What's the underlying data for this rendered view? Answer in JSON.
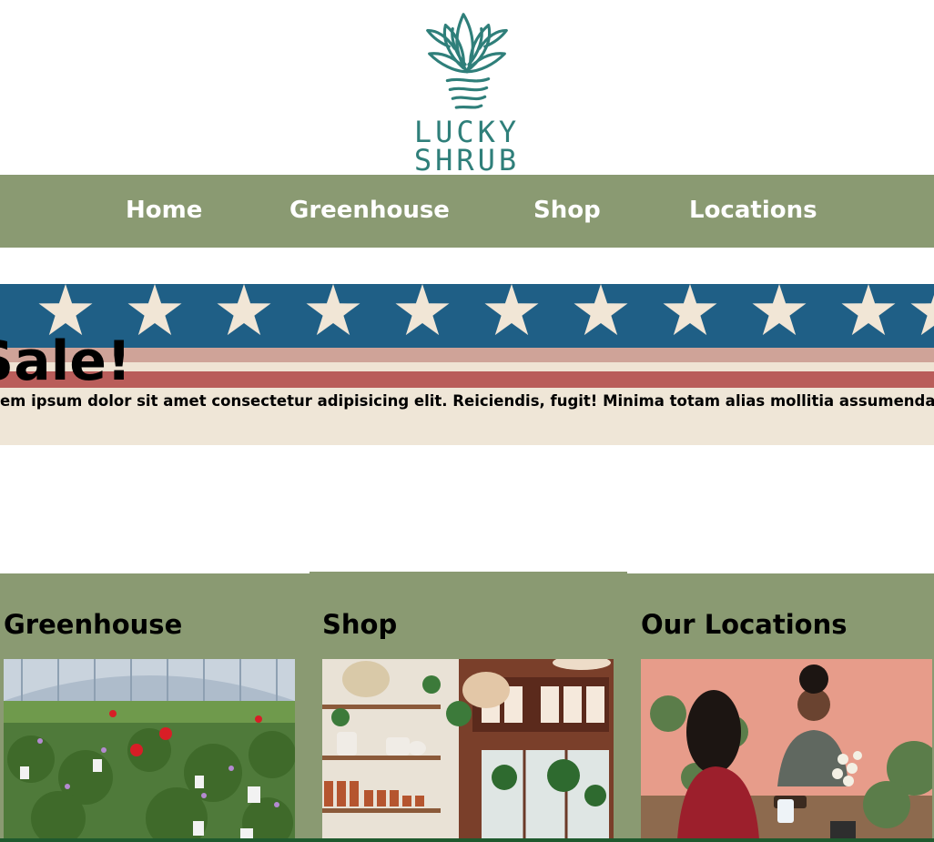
{
  "brand": {
    "line1": "LUCKY",
    "line2": "SHRUB"
  },
  "nav": {
    "items": [
      {
        "label": "Home"
      },
      {
        "label": "Greenhouse"
      },
      {
        "label": "Shop"
      },
      {
        "label": "Locations"
      }
    ]
  },
  "banner": {
    "title": "Sale!",
    "text": "Lorem ipsum dolor sit amet consectetur adipisicing elit. Reiciendis, fugit! Minima totam alias mollitia assumenda fugiat laudantium amet excepturi obcaecati est"
  },
  "cards": [
    {
      "title": "Greenhouse",
      "image": "greenhouse-photo"
    },
    {
      "title": "Shop",
      "image": "shop-interior-photo"
    },
    {
      "title": "Our Locations",
      "image": "store-checkout-photo"
    }
  ],
  "colors": {
    "nav_bg": "#8a9a72",
    "brand_teal": "#2f7f7a",
    "flag_blue": "#1f5f86",
    "flag_red": "#b95d5a",
    "banner_cream": "#efe6d7"
  }
}
